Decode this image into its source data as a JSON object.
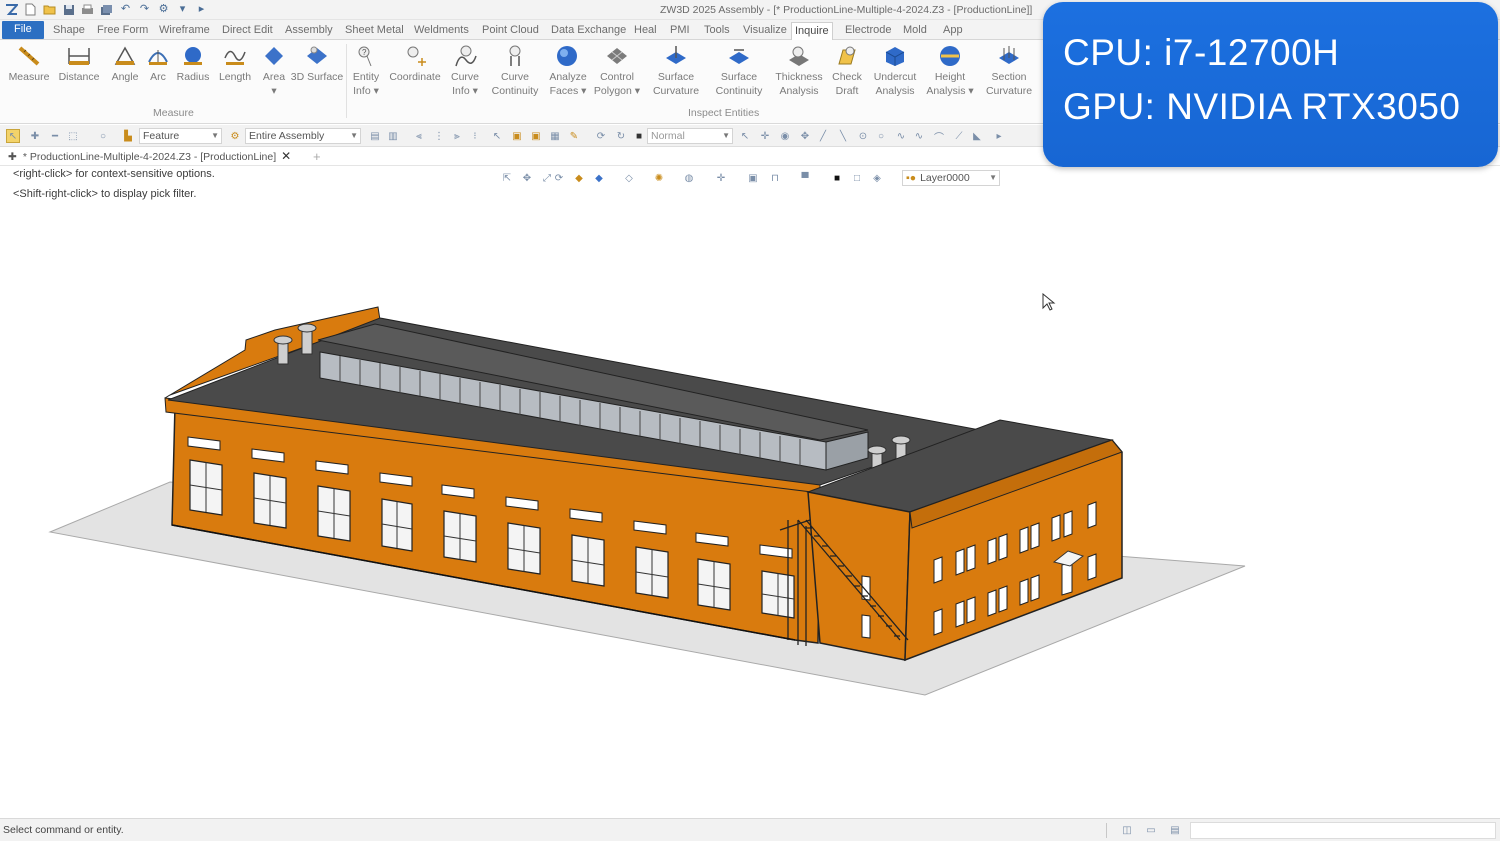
{
  "window": {
    "title": "ZW3D 2025   Assembly - [* ProductionLine-Multiple-4-2024.Z3 - [ProductionLine]]"
  },
  "quick_access": [
    "app-logo-icon",
    "new-icon",
    "open-icon",
    "save-icon",
    "print-icon",
    "save-all-icon",
    "undo-icon",
    "redo-icon",
    "settings-icon",
    "dropdown-icon",
    "play-icon"
  ],
  "menu": {
    "tabs": [
      "File",
      "Shape",
      "Free Form",
      "Wireframe",
      "Direct Edit",
      "Assembly",
      "Sheet Metal",
      "Weldments",
      "Point Cloud",
      "Data Exchange",
      "Heal",
      "PMI",
      "Tools",
      "Visualize",
      "Inquire",
      "Electrode",
      "Mold",
      "App"
    ],
    "active": "Inquire"
  },
  "ribbon": {
    "groups": [
      {
        "label": "Measure"
      },
      {
        "label": "Inspect Entities"
      }
    ],
    "buttons": [
      {
        "line1": "Measure",
        "line2": ""
      },
      {
        "line1": "Distance",
        "line2": ""
      },
      {
        "line1": "Angle",
        "line2": ""
      },
      {
        "line1": "Arc",
        "line2": ""
      },
      {
        "line1": "Radius",
        "line2": ""
      },
      {
        "line1": "Length",
        "line2": ""
      },
      {
        "line1": "Area",
        "line2": "▾"
      },
      {
        "line1": "3D Surface",
        "line2": ""
      },
      {
        "line1": "Entity",
        "line2": "Info ▾"
      },
      {
        "line1": "Coordinate",
        "line2": ""
      },
      {
        "line1": "Curve",
        "line2": "Info ▾"
      },
      {
        "line1": "Curve",
        "line2": "Continuity"
      },
      {
        "line1": "Analyze",
        "line2": "Faces ▾"
      },
      {
        "line1": "Control",
        "line2": "Polygon ▾"
      },
      {
        "line1": "Surface",
        "line2": "Curvature"
      },
      {
        "line1": "Surface",
        "line2": "Continuity"
      },
      {
        "line1": "Thickness",
        "line2": "Analysis"
      },
      {
        "line1": "Check",
        "line2": "Draft"
      },
      {
        "line1": "Undercut",
        "line2": "Analysis"
      },
      {
        "line1": "Height",
        "line2": "Analysis ▾"
      },
      {
        "line1": "Section",
        "line2": "Curvature"
      }
    ]
  },
  "filter_bar": {
    "filter_value": "Feature",
    "scope_value": "Entire Assembly",
    "style_value": "Normal"
  },
  "document_tabs": {
    "active_tab": "* ProductionLine-Multiple-4-2024.Z3 - [ProductionLine]",
    "add_symbol": "+"
  },
  "viewport": {
    "hints": [
      "<right-click> for context-sensitive options.",
      "<Shift-right-click> to display pick filter."
    ],
    "layer_value": "Layer0000"
  },
  "status": {
    "text": "Select command or entity."
  },
  "overlay": {
    "cpu": "CPU: i7-12700H",
    "gpu": "GPU:  NVIDIA RTX3050"
  },
  "colors": {
    "file_tab": "#2c6fc2",
    "wall": "#d97b0e",
    "roof": "#4a4a4a",
    "ground": "#e2e2e2",
    "overlay": "#1c70e0"
  }
}
